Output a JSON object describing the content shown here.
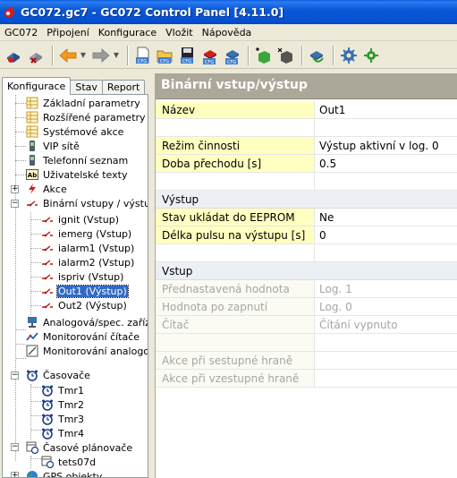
{
  "window": {
    "title": "GC072.gc7 - GC072 Control Panel [4.11.0]"
  },
  "menu": [
    {
      "label": "GC072"
    },
    {
      "label": "Připojení"
    },
    {
      "label": "Konfigurace"
    },
    {
      "label": "Vložit"
    },
    {
      "label": "Nápověda"
    }
  ],
  "toolbar": {
    "buttons": [
      {
        "icon": "connect-icon"
      },
      {
        "icon": "disconnect-icon"
      },
      {
        "icon": "back-arrow-icon"
      },
      {
        "icon": "forward-arrow-icon"
      },
      {
        "icon": "new-cfg-icon",
        "text": "CFG"
      },
      {
        "icon": "open-cfg-icon",
        "text": "CFG"
      },
      {
        "icon": "save-cfg-icon",
        "text": "CFG"
      },
      {
        "icon": "read-cfg-icon",
        "text": "CFG"
      },
      {
        "icon": "write-cfg-icon",
        "text": "CFG"
      },
      {
        "icon": "add-item-icon"
      },
      {
        "icon": "remove-item-icon"
      },
      {
        "icon": "sync-icon"
      },
      {
        "icon": "settings-icon"
      },
      {
        "icon": "tools-icon"
      }
    ]
  },
  "tabs": [
    {
      "label": "Konfigurace",
      "active": true
    },
    {
      "label": "Stav",
      "active": false
    },
    {
      "label": "Report",
      "active": false
    }
  ],
  "tree": [
    {
      "label": "Základní parametry",
      "icon": "table-icon"
    },
    {
      "label": "Rozšířené parametry",
      "icon": "table-icon"
    },
    {
      "label": "Systémové akce",
      "icon": "table-icon"
    },
    {
      "label": "VIP sítě",
      "icon": "phone-icon"
    },
    {
      "label": "Telefonní seznam",
      "icon": "phone-icon"
    },
    {
      "label": "Uživatelské texty",
      "icon": "text-icon",
      "iconText": "Ab"
    },
    {
      "label": "Akce",
      "icon": "lightning-icon"
    },
    {
      "label": "Binární vstupy / výstupy",
      "icon": "switch-icon"
    },
    {
      "label": "ignit (Vstup)",
      "icon": "switch-icon"
    },
    {
      "label": "iemerg (Vstup)",
      "icon": "switch-icon"
    },
    {
      "label": "ialarm1 (Vstup)",
      "icon": "switch-icon"
    },
    {
      "label": "ialarm2 (Vstup)",
      "icon": "switch-icon"
    },
    {
      "label": "ispriv (Vstup)",
      "icon": "switch-icon"
    },
    {
      "label": "Out1 (Výstup)",
      "icon": "switch-icon",
      "selected": true
    },
    {
      "label": "Out2 (Výstup)",
      "icon": "switch-icon"
    },
    {
      "label": "Analogová/spec. zařízení",
      "icon": "analog-device-icon"
    },
    {
      "label": "Monitorování čítače",
      "icon": "counter-monitor-icon"
    },
    {
      "label": "Monitorování analogových",
      "icon": "analog-monitor-icon"
    },
    {
      "label": "Časovače",
      "icon": "alarm-clock-icon"
    },
    {
      "label": "Tmr1",
      "icon": "alarm-clock-icon"
    },
    {
      "label": "Tmr2",
      "icon": "alarm-clock-icon"
    },
    {
      "label": "Tmr3",
      "icon": "alarm-clock-icon"
    },
    {
      "label": "Tmr4",
      "icon": "alarm-clock-icon"
    },
    {
      "label": "Časové plánovače",
      "icon": "scheduler-icon"
    },
    {
      "label": "tets07d",
      "icon": "scheduler-icon"
    },
    {
      "label": "GPS objekty",
      "icon": "globe-icon"
    }
  ],
  "panel": {
    "header": "Binární vstup/výstup",
    "rows": [
      {
        "name": "Název",
        "value": "Out1",
        "kind": "active"
      },
      {
        "name": "",
        "value": "",
        "kind": "blank"
      },
      {
        "name": "Režim činnosti",
        "value": "Výstup aktivní v log. 0",
        "kind": "active"
      },
      {
        "name": "Doba přechodu [s]",
        "value": "0.5",
        "kind": "active"
      },
      {
        "name": "",
        "value": "",
        "kind": "blank"
      },
      {
        "name": "Výstup",
        "value": "",
        "kind": "section"
      },
      {
        "name": "Stav ukládat do EEPROM",
        "value": "Ne",
        "kind": "active"
      },
      {
        "name": "Délka pulsu na výstupu [s]",
        "value": "0",
        "kind": "active"
      },
      {
        "name": "",
        "value": "",
        "kind": "blank"
      },
      {
        "name": "Vstup",
        "value": "",
        "kind": "section"
      },
      {
        "name": "Přednastavená hodnota",
        "value": "Log. 1",
        "kind": "disabled"
      },
      {
        "name": "Hodnota po zapnutí",
        "value": "Log. 0",
        "kind": "disabled"
      },
      {
        "name": "Čítač",
        "value": "Čítání vypnuto",
        "kind": "disabled"
      },
      {
        "name": "",
        "value": "",
        "kind": "disabled"
      },
      {
        "name": "Akce při sestupné hraně",
        "value": "",
        "kind": "disabled"
      },
      {
        "name": "Akce při vzestupné hraně",
        "value": "",
        "kind": "disabled"
      }
    ]
  },
  "colors": {
    "titlebar": "#0a58d6",
    "header": "#aca899",
    "active_row": "#ffffc0",
    "section_row": "#ecf0f5",
    "selection": "#316ac5"
  }
}
